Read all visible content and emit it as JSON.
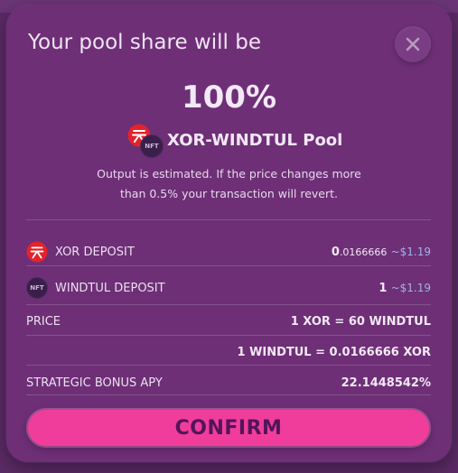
{
  "dialog": {
    "title": "Your pool share will be",
    "share_percent": "100%",
    "pool_name": "XOR-WINDTUL Pool",
    "note_line1": "Output is estimated. If the price changes more",
    "note_line2": "than 0.5% your transaction will revert.",
    "confirm_label": "CONFIRM"
  },
  "rows": {
    "xor_deposit": {
      "label": "XOR DEPOSIT",
      "value_int": "0",
      "value_frac": ".0166666",
      "fiat": "~$1.19"
    },
    "windtul_deposit": {
      "label": "WINDTUL DEPOSIT",
      "value": "1",
      "fiat": "~$1.19"
    },
    "price": {
      "label": "PRICE",
      "value1": "1 XOR = 60 WINDTUL",
      "value2": "1 WINDTUL = 0.0166666 XOR"
    },
    "apy": {
      "label": "STRATEGIC BONUS APY",
      "value": "22.1448542%"
    }
  },
  "icons": {
    "close": "close-icon",
    "xor": "xor-token-icon",
    "nft": "nft-token-icon"
  },
  "colors": {
    "accent": "#f03d9b",
    "background": "#6e2f77",
    "xor_red": "#e3232c",
    "nft_purple": "#3a1f4a",
    "fiat_blue": "#9fb3e6"
  },
  "nft_badge": "NFT"
}
